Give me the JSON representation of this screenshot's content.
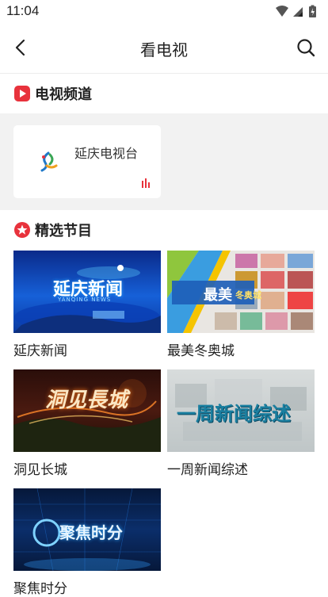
{
  "status_bar": {
    "time": "11:04"
  },
  "header": {
    "title": "看电视"
  },
  "channels_section": {
    "title": "电视频道",
    "channels": [
      {
        "name": "延庆电视台"
      }
    ]
  },
  "programs_section": {
    "title": "精选节目",
    "programs": [
      {
        "name": "延庆新闻",
        "thumb_text": "延庆新闻",
        "thumb_sub": "YANQING NEWS"
      },
      {
        "name": "最美冬奥城",
        "thumb_text": "最美",
        "thumb_text2": "冬奥城"
      },
      {
        "name": "洞见长城",
        "thumb_text": "洞见長城"
      },
      {
        "name": "一周新闻综述",
        "thumb_text": "一周新闻综述"
      },
      {
        "name": "聚焦时分",
        "thumb_text": "聚焦时分"
      }
    ]
  },
  "colors": {
    "accent": "#e8323c",
    "band": "#f2f2f2"
  }
}
